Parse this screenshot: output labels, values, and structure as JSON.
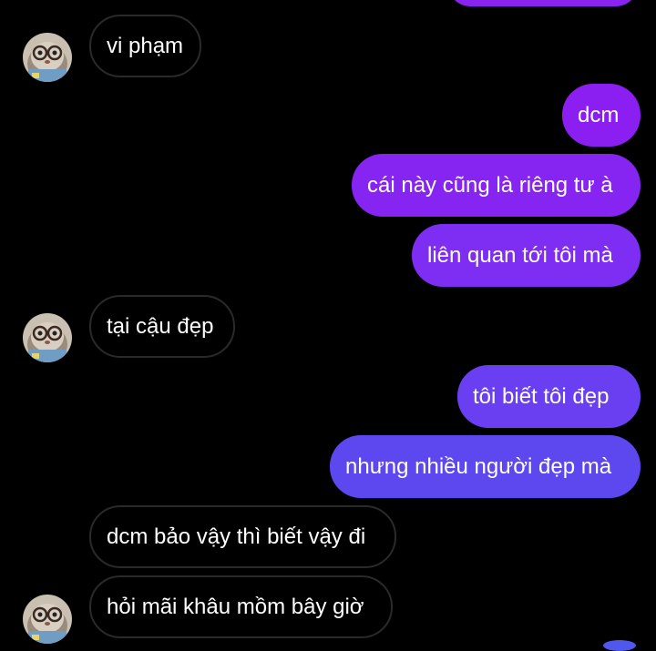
{
  "messages": [
    {
      "side": "in",
      "text": "vi phạm"
    },
    {
      "side": "out",
      "text": "dcm"
    },
    {
      "side": "out",
      "text": "cái này cũng là riêng tư à"
    },
    {
      "side": "out",
      "text": "liên quan tới tôi mà"
    },
    {
      "side": "in",
      "text": "tại cậu đẹp"
    },
    {
      "side": "out",
      "text": "tôi biết tôi đẹp"
    },
    {
      "side": "out",
      "text": "nhưng nhiều người đẹp mà"
    },
    {
      "side": "in",
      "text": "dcm bảo vậy thì biết vậy đi"
    },
    {
      "side": "in",
      "text": "hỏi mãi khâu mồm bây giờ"
    }
  ],
  "avatar": {
    "icon": "cat-with-glasses-avatar-icon"
  },
  "colors": {
    "background": "#000000",
    "incoming_bubble_border": "#2a2a2a",
    "outgoing_gradient": [
      "#8b1ff1",
      "#7a2ff2",
      "#6a3ff2",
      "#5a4af0"
    ]
  }
}
